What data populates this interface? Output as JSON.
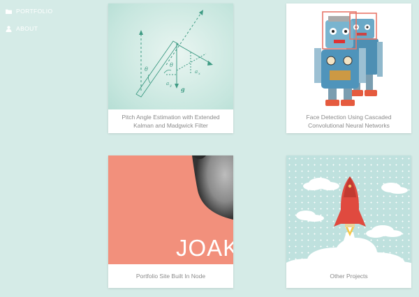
{
  "nav": {
    "items": [
      {
        "label": "PORTFOLIO",
        "icon": "folder-icon"
      },
      {
        "label": "ABOUT",
        "icon": "user-icon"
      }
    ]
  },
  "cards": [
    {
      "title_line1": "Pitch Angle Estimation with Extended",
      "title_line2": "Kalman and Madgwick Filter",
      "image": "imu-diagram",
      "diagram_labels": {
        "theta_left": "θ",
        "theta_right": "θ",
        "a_x": "a",
        "a_x_sub": "x",
        "a_y": "a",
        "a_y_sub": "y",
        "g": "g"
      }
    },
    {
      "title_line1": "Face Detection Using Cascaded",
      "title_line2": "Convolutional Neural Networks",
      "image": "robot-toys"
    },
    {
      "title_line1": "Portfolio Site Built In Node",
      "title_line2": "",
      "image": "portfolio-joak",
      "image_text": "JOAK"
    },
    {
      "title_line1": "Other Projects",
      "title_line2": "",
      "image": "rocket-illustration"
    }
  ],
  "colors": {
    "background": "#d5ebe7",
    "teal": "#3f9b84",
    "salmon": "#f2907c",
    "face_box": "#e8776a"
  }
}
